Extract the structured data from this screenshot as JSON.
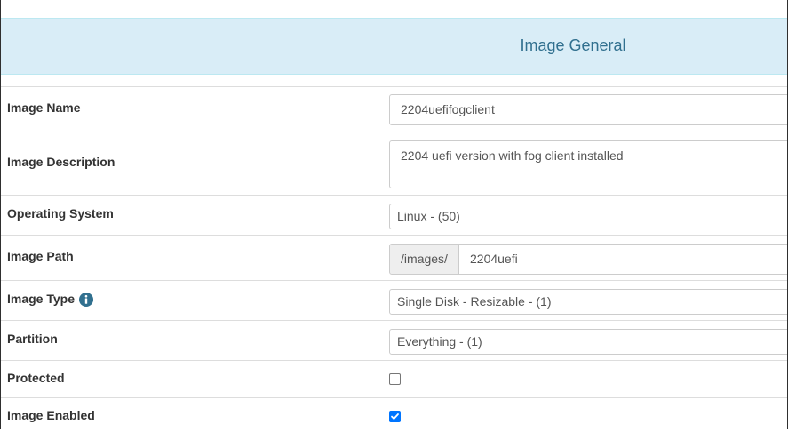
{
  "panel": {
    "title": "Image General"
  },
  "form": {
    "image_name": {
      "label": "Image Name",
      "value": "2204uefifogclient"
    },
    "image_description": {
      "label": "Image Description",
      "value": "2204 uefi version with fog client installed"
    },
    "operating_system": {
      "label": "Operating System",
      "selected": "Linux - (50)"
    },
    "image_path": {
      "label": "Image Path",
      "prefix": "/images/",
      "value": "2204uefi"
    },
    "image_type": {
      "label": "Image Type",
      "selected": "Single Disk - Resizable - (1)",
      "info_icon": "info-circle-icon"
    },
    "partition": {
      "label": "Partition",
      "selected": "Everything - (1)"
    },
    "protected": {
      "label": "Protected",
      "checked": false
    },
    "image_enabled": {
      "label": "Image Enabled",
      "checked": true
    }
  },
  "colors": {
    "heading_bg": "#d9edf7",
    "heading_text": "#31708f",
    "checkbox_accent": "#0075ff"
  }
}
